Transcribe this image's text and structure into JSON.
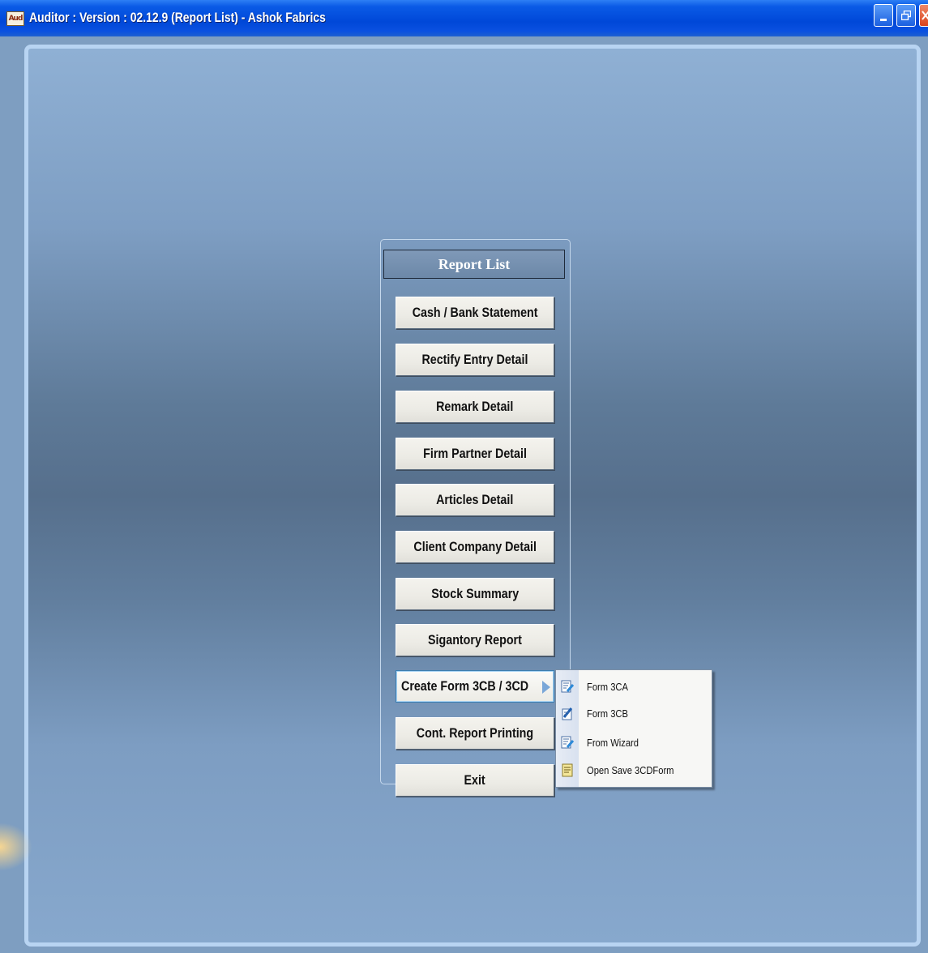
{
  "window": {
    "icon_text": "Aud",
    "title": "Auditor : Version : 02.12.9 (Report List) - Ashok Fabrics",
    "controls": {
      "minimize": "minimize-icon",
      "restore": "restore-icon",
      "close": "close-icon"
    }
  },
  "report_list": {
    "title": "Report List",
    "buttons": [
      "Cash / Bank Statement",
      "Rectify Entry Detail",
      "Remark Detail",
      "Firm Partner Detail",
      "Articles Detail",
      "Client Company Detail",
      "Stock Summary",
      "Sigantory Report",
      "Create Form 3CB / 3CD",
      "Cont. Report Printing",
      "Exit"
    ],
    "active_button_index": 8
  },
  "submenu": {
    "items": [
      {
        "label": "Form 3CA",
        "icon": "form-edit-icon"
      },
      {
        "label": "Form 3CB",
        "icon": "form-write-icon"
      },
      {
        "label": "From Wizard",
        "icon": "wizard-icon"
      },
      {
        "label": "Open Save 3CDForm",
        "icon": "saved-form-icon"
      }
    ]
  },
  "colors": {
    "titlebar": "#0048d8",
    "frame_border": "#b8d4f2",
    "background": "#7e9ec1"
  }
}
